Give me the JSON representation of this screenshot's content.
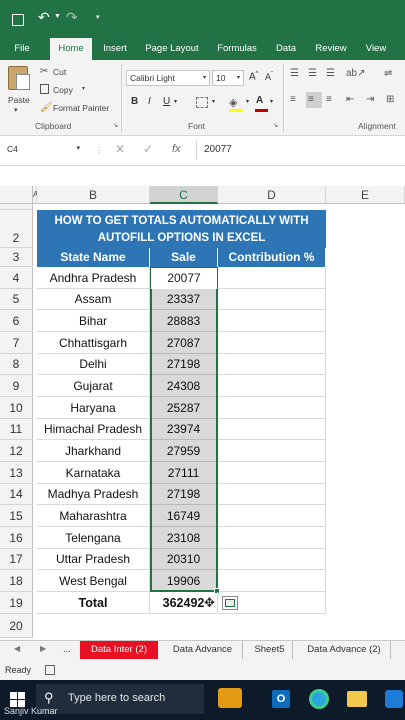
{
  "ribbon_tabs": [
    "File",
    "Home",
    "Insert",
    "Page Layout",
    "Formulas",
    "Data",
    "Review",
    "View"
  ],
  "clipboard": {
    "paste": "Paste",
    "cut": "Cut",
    "copy": "Copy",
    "format_painter": "Format Painter",
    "group": "Clipboard"
  },
  "font": {
    "name": "Calibri Light",
    "size": "10",
    "group": "Font",
    "bold": "B",
    "italic": "I",
    "underline": "U"
  },
  "alignment": {
    "group": "Alignment"
  },
  "formula_bar": {
    "name_box": "C4",
    "fx": "fx",
    "value": "20077"
  },
  "columns": [
    "A",
    "B",
    "C",
    "D",
    "E"
  ],
  "banner": {
    "line1": "HOW TO GET TOTALS AUTOMATICALLY WITH",
    "line2": "AUTOFILL OPTIONS IN EXCEL"
  },
  "headers": {
    "state": "State Name",
    "sale": "Sale",
    "contribution": "Contribution %"
  },
  "rows": [
    {
      "num": "4",
      "state": "Andhra Pradesh",
      "sale": "20077"
    },
    {
      "num": "5",
      "state": "Assam",
      "sale": "23337"
    },
    {
      "num": "6",
      "state": "Bihar",
      "sale": "28883"
    },
    {
      "num": "7",
      "state": "Chhattisgarh",
      "sale": "27087"
    },
    {
      "num": "8",
      "state": "Delhi",
      "sale": "27198"
    },
    {
      "num": "9",
      "state": "Gujarat",
      "sale": "24308"
    },
    {
      "num": "10",
      "state": "Haryana",
      "sale": "25287"
    },
    {
      "num": "11",
      "state": "Himachal Pradesh",
      "sale": "23974"
    },
    {
      "num": "12",
      "state": "Jharkhand",
      "sale": "27959"
    },
    {
      "num": "13",
      "state": "Karnataka",
      "sale": "27111"
    },
    {
      "num": "14",
      "state": "Madhya Pradesh",
      "sale": "27198"
    },
    {
      "num": "15",
      "state": "Maharashtra",
      "sale": "16749"
    },
    {
      "num": "16",
      "state": "Telengana",
      "sale": "23108"
    },
    {
      "num": "17",
      "state": "Uttar Pradesh",
      "sale": "20310"
    },
    {
      "num": "18",
      "state": "West Bengal",
      "sale": "19906"
    }
  ],
  "total": {
    "num": "19",
    "label": "Total",
    "value": "362492"
  },
  "row_labels": {
    "r2": "2",
    "r3": "3",
    "r20": "20"
  },
  "sheet_tabs": [
    "...",
    "Data Inter (2)",
    "Data Advance",
    "Sheet5",
    "Data Advance (2)"
  ],
  "status": {
    "ready": "Ready"
  },
  "taskbar": {
    "search_placeholder": "Type here to search",
    "watermark": "Sanjiv Kumar"
  },
  "colors": {
    "excel_green": "#217346",
    "header_blue": "#2e75b6",
    "active_sheet": "#e81123"
  }
}
